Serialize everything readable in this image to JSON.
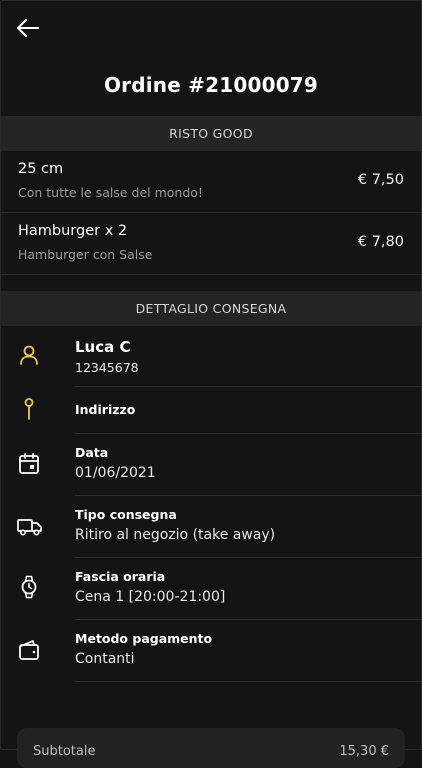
{
  "header": {
    "title": "Ordine #21000079"
  },
  "restaurant": {
    "name": "RISTO GOOD"
  },
  "items": [
    {
      "name": "25 cm",
      "description": "Con tutte le salse del mondo!",
      "price": "€ 7,50"
    },
    {
      "name": "Hamburger x 2",
      "description": "Hamburger con Salse",
      "price": "€ 7,80"
    }
  ],
  "delivery": {
    "section_title": "DETTAGLIO CONSEGNA",
    "customer_name": "Luca C",
    "customer_phone": "12345678",
    "address_label": "Indirizzo",
    "date_label": "Data",
    "date_value": "01/06/2021",
    "type_label": "Tipo consegna",
    "type_value": "Ritiro al negozio (take away)",
    "slot_label": "Fascia oraria",
    "slot_value": "Cena 1 [20:00-21:00]",
    "payment_label": "Metodo pagamento",
    "payment_value": "Contanti"
  },
  "summary": {
    "label": "Subtotale",
    "total": "15,30 €"
  },
  "colors": {
    "accent": "#f2c744",
    "background": "#141414",
    "section": "#242424"
  },
  "icons": {
    "back": "arrow-left-icon",
    "customer": "user-icon",
    "address": "pin-icon",
    "date": "calendar-icon",
    "type": "truck-icon",
    "slot": "watch-icon",
    "payment": "wallet-icon"
  }
}
